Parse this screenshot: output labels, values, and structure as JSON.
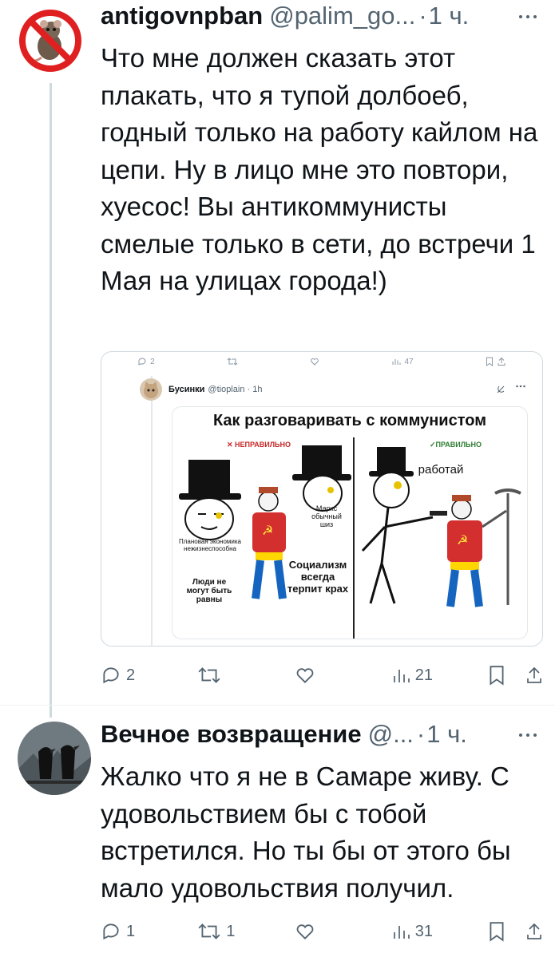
{
  "tweet1": {
    "author_name": "antigovnpban",
    "author_handle": "@palim_go...",
    "separator": "·",
    "time": "1 ч.",
    "text": "Что мне должен сказать этот плакать, что я тупой долбоеб, годный только на работу кайлом на цепи. Ну в лицо мне это повтори, хуесос! Вы антикоммунисты смелые только в сети, до встречи 1 Мая на улицах города!)",
    "embed": {
      "inner_bar": {
        "replies": "2",
        "views": "47"
      },
      "inner_author": "Бусинки",
      "inner_handle": "@tioplain · 1h",
      "meme": {
        "title": "Как разговаривать с коммунистом",
        "wrong": "✕ НЕПРАВИЛЬНО",
        "right": "✓ПРАВИЛЬНО",
        "labels": {
          "planned": "Плановая экономика нежизнеспособна",
          "people": "Люди не могут быть равны",
          "marx": "Маркс обычный шиз",
          "socialism": "Социализм всегда терпит крах",
          "work": "работай"
        }
      }
    },
    "actions": {
      "replies": "2",
      "retweets": "",
      "likes": "",
      "views": "21"
    }
  },
  "tweet2": {
    "author_name": "Вечное возвращение",
    "author_handle": "@...",
    "separator": "·",
    "time": "1 ч.",
    "text": "Жалко что я не в Самаре живу. С удовольствием бы с тобой встретился. Но ты бы от этого бы мало удовольствия получил.",
    "actions": {
      "replies": "1",
      "retweets": "1",
      "likes": "",
      "views": "31"
    }
  },
  "colors": {
    "text": "#0f1419",
    "secondary": "#536471",
    "border": "#cfd9de",
    "soviet_red": "#d32f2f"
  },
  "icons": [
    "no-rat-icon",
    "crows-avatar",
    "reply-icon",
    "retweet-icon",
    "like-icon",
    "views-icon",
    "bookmark-icon",
    "share-icon",
    "more-icon"
  ]
}
